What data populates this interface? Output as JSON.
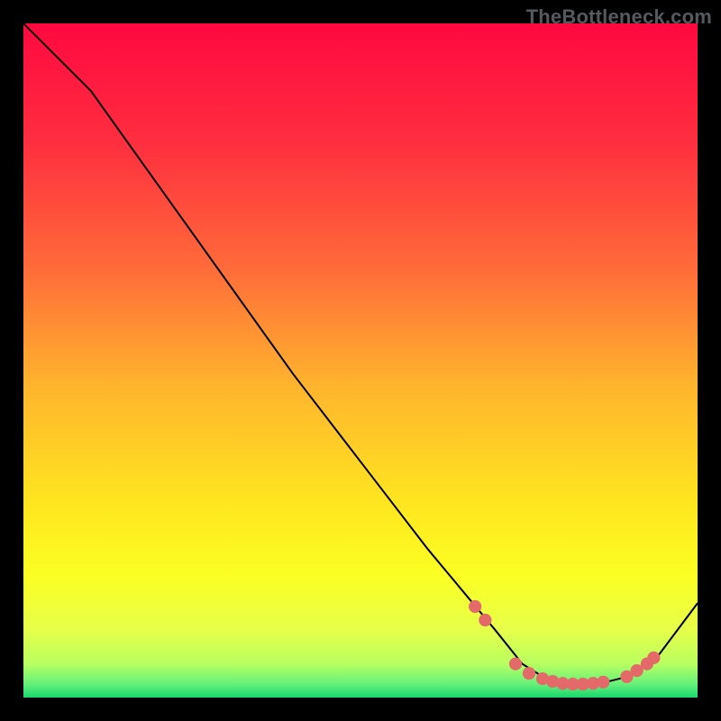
{
  "watermark": "TheBottleneck.com",
  "chart_data": {
    "type": "line",
    "title": "",
    "xlabel": "",
    "ylabel": "",
    "xlim": [
      0,
      100
    ],
    "ylim": [
      0,
      100
    ],
    "grid": false,
    "legend": false,
    "gradient_stops": [
      {
        "offset": 0,
        "color": "#ff0840"
      },
      {
        "offset": 18,
        "color": "#ff2f3f"
      },
      {
        "offset": 36,
        "color": "#ff6a3a"
      },
      {
        "offset": 54,
        "color": "#ffb52d"
      },
      {
        "offset": 72,
        "color": "#ffe81f"
      },
      {
        "offset": 82,
        "color": "#fbff23"
      },
      {
        "offset": 90,
        "color": "#e6ff4a"
      },
      {
        "offset": 95,
        "color": "#b8ff60"
      },
      {
        "offset": 98,
        "color": "#66f07a"
      },
      {
        "offset": 100,
        "color": "#19d86e"
      }
    ],
    "series": [
      {
        "name": "curve",
        "color": "#000000",
        "x": [
          0,
          10,
          20,
          30,
          40,
          50,
          60,
          70,
          74,
          78,
          82,
          86,
          90,
          94,
          100
        ],
        "y": [
          100,
          90,
          76,
          62,
          48,
          35,
          22,
          10,
          5,
          2.5,
          2,
          2.2,
          3.2,
          6,
          14
        ]
      }
    ],
    "markers": {
      "color": "#e46a6a",
      "points": [
        {
          "x": 67,
          "y": 13.5
        },
        {
          "x": 68.5,
          "y": 11.5
        },
        {
          "x": 73,
          "y": 5
        },
        {
          "x": 75,
          "y": 3.6
        },
        {
          "x": 77,
          "y": 2.8
        },
        {
          "x": 78.5,
          "y": 2.4
        },
        {
          "x": 80,
          "y": 2.1
        },
        {
          "x": 81.5,
          "y": 2.0
        },
        {
          "x": 83,
          "y": 2.0
        },
        {
          "x": 84.5,
          "y": 2.1
        },
        {
          "x": 86,
          "y": 2.3
        },
        {
          "x": 89.5,
          "y": 3.1
        },
        {
          "x": 91,
          "y": 4.0
        },
        {
          "x": 92.5,
          "y": 5.0
        },
        {
          "x": 93.5,
          "y": 5.9
        }
      ]
    }
  }
}
